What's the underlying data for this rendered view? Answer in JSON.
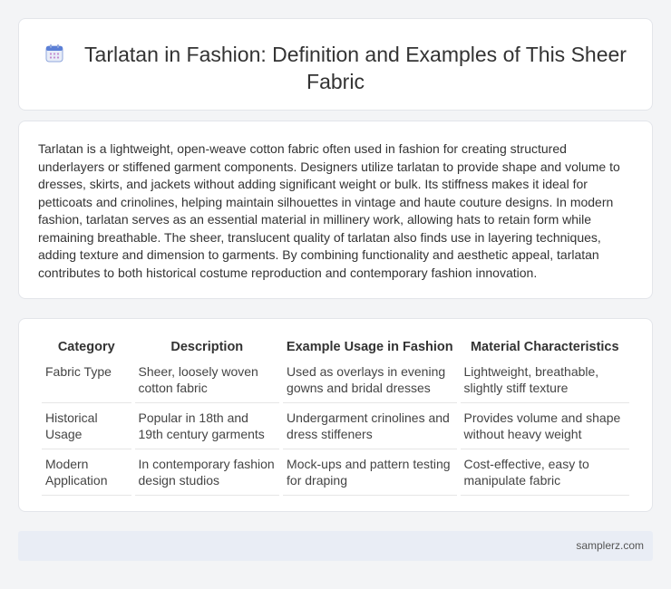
{
  "header": {
    "icon": "calendar-icon",
    "title": "Tarlatan in Fashion: Definition and Examples of This Sheer Fabric"
  },
  "intro": {
    "text": "Tarlatan is a lightweight, open-weave cotton fabric often used in fashion for creating structured underlayers or stiffened garment components. Designers utilize tarlatan to provide shape and volume to dresses, skirts, and jackets without adding significant weight or bulk. Its stiffness makes it ideal for petticoats and crinolines, helping maintain silhouettes in vintage and haute couture designs. In modern fashion, tarlatan serves as an essential material in millinery work, allowing hats to retain form while remaining breathable. The sheer, translucent quality of tarlatan also finds use in layering techniques, adding texture and dimension to garments. By combining functionality and aesthetic appeal, tarlatan contributes to both historical costume reproduction and contemporary fashion innovation."
  },
  "table": {
    "headers": [
      "Category",
      "Description",
      "Example Usage in Fashion",
      "Material Characteristics"
    ],
    "rows": [
      [
        "Fabric Type",
        "Sheer, loosely woven cotton fabric",
        "Used as overlays in evening gowns and bridal dresses",
        "Lightweight, breathable, slightly stiff texture"
      ],
      [
        "Historical Usage",
        "Popular in 18th and 19th century garments",
        "Undergarment crinolines and dress stiffeners",
        "Provides volume and shape without heavy weight"
      ],
      [
        "Modern Application",
        "In contemporary fashion design studios",
        "Mock-ups and pattern testing for draping",
        "Cost-effective, easy to manipulate fabric"
      ]
    ]
  },
  "footer": {
    "text": "samplerz.com"
  },
  "colors": {
    "background": "#f3f4f6",
    "card": "#ffffff",
    "footer": "#e9edf5",
    "icon_accent": "#5b7fd6"
  }
}
